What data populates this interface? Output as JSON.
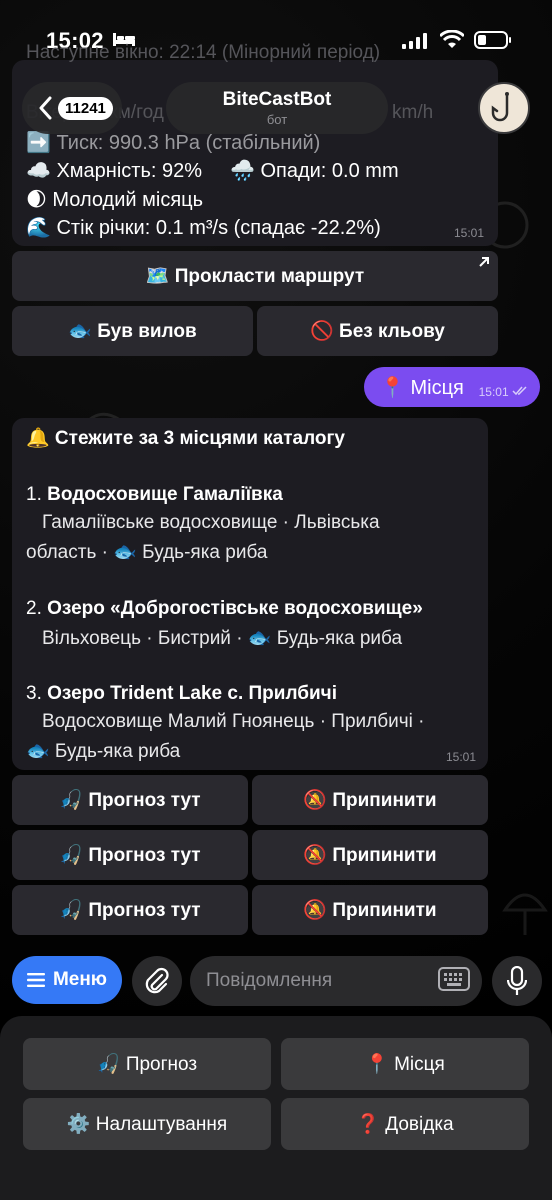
{
  "status": {
    "time": "15:02"
  },
  "header": {
    "unread": "11241",
    "bot_name": "BiteCastBot",
    "bot_subtitle": "бот"
  },
  "weather_message": {
    "faded_top": "Наступне вікно: 22:14 (Мінорний період)",
    "faded_wind": "Вітер: 20 км/год",
    "faded_wind_unit": "km/h",
    "pressure": "➡️ Тиск: 990.3 hPa (стабільний)",
    "clouds": "☁️ Хмарність: 92%",
    "rain": "🌧️ Опади: 0.0 mm",
    "moon": "🌒 Молодий місяць",
    "river": "🌊 Стік річки: 0.1 m³/s (спадає -22.2%)",
    "time": "15:01"
  },
  "weather_keyboard": {
    "route": "🗺️ Прокласти маршрут",
    "had_bite": "🐟 Був вилов",
    "no_bite": "🚫 Без кльову"
  },
  "outgoing": {
    "text": "📍 Місця",
    "time": "15:01"
  },
  "places_message": {
    "title": "🔔 Стежите за 3 місцями каталогу",
    "items": [
      {
        "num": "1.",
        "name": "Водосховище Гамаліївка",
        "line1": "Гамаліївське водосховище · Львівська",
        "line2": "область · 🐟 Будь-яка риба"
      },
      {
        "num": "2.",
        "name": "Озеро «Доброгостівське водосховище»",
        "line1": "Вільховець · Бистрий · 🐟 Будь-яка риба"
      },
      {
        "num": "3.",
        "name": "Озеро Trident Lake с. Прилбичі",
        "line1": "Водосховище Малий Гноянець · Прилбичі ·",
        "line2": "🐟 Будь-яка риба"
      }
    ],
    "time": "15:01"
  },
  "places_keyboard": {
    "forecast": "🎣 Прогноз тут",
    "stop": "🔕 Припинити"
  },
  "input": {
    "menu": "Меню",
    "placeholder": "Повідомлення"
  },
  "reply_keyboard": {
    "forecast": "🎣 Прогноз",
    "places": "📍 Місця",
    "settings": "⚙️ Налаштування",
    "help": "❓ Довідка"
  },
  "colors": {
    "accent": "#3579f6",
    "outgoing": "#7b4cf0",
    "bubble": "#1d1c22"
  }
}
